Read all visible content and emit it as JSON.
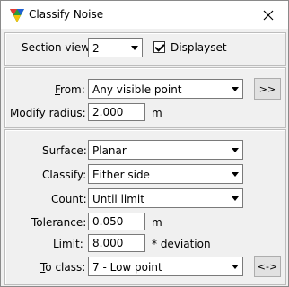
{
  "window": {
    "title": "Classify Noise"
  },
  "section_view": {
    "label": "Section view:",
    "value": "2",
    "displayset_label": "Displayset",
    "displayset_checked": true
  },
  "from": {
    "label_acc": "F",
    "label_rest": "rom:",
    "value": "Any visible point",
    "button_label": ">>"
  },
  "modify_radius": {
    "label": "Modify radius:",
    "value": "2.000",
    "unit": "m"
  },
  "surface": {
    "label": "Surface:",
    "value": "Planar"
  },
  "classify": {
    "label": "Classify:",
    "value": "Either side"
  },
  "count": {
    "label": "Count:",
    "value": "Until limit"
  },
  "tolerance": {
    "label": "Tolerance:",
    "value": "0.050",
    "unit": "m"
  },
  "limit": {
    "label": "Limit:",
    "value": "8.000",
    "unit": "* deviation"
  },
  "to_class": {
    "label_acc": "T",
    "label_rest": "o class:",
    "value": "7 - Low point",
    "button_label": "<->"
  }
}
